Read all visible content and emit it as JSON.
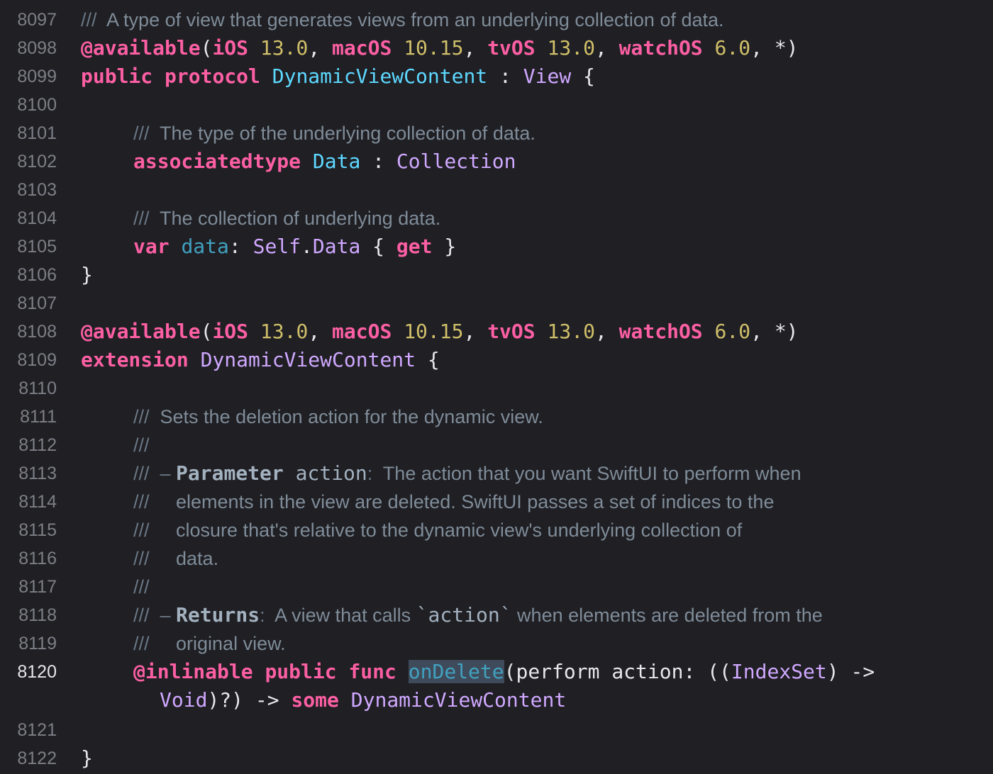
{
  "editor": {
    "colors": {
      "background": "#1f1f24",
      "keyword": "#fc5fa3",
      "type": "#d0a8ff",
      "identifier": "#5dd8ff",
      "number": "#d0bf69",
      "comment": "#7f8c98",
      "selection": "#3f4b5a"
    },
    "current_line": "8120",
    "lines": [
      {
        "num": "8097",
        "indent": 0,
        "segs": [
          [
            "slashes",
            "/// "
          ],
          [
            "comment",
            " A type of view that generates views from an underlying collection of data."
          ]
        ]
      },
      {
        "num": "8098",
        "indent": 0,
        "segs": [
          [
            "attr",
            "@available"
          ],
          [
            "plain",
            "("
          ],
          [
            "keyword",
            "iOS"
          ],
          [
            "plain",
            " "
          ],
          [
            "num",
            "13.0"
          ],
          [
            "plain",
            ", "
          ],
          [
            "keyword",
            "macOS"
          ],
          [
            "plain",
            " "
          ],
          [
            "num",
            "10.15"
          ],
          [
            "plain",
            ", "
          ],
          [
            "keyword",
            "tvOS"
          ],
          [
            "plain",
            " "
          ],
          [
            "num",
            "13.0"
          ],
          [
            "plain",
            ", "
          ],
          [
            "keyword",
            "watchOS"
          ],
          [
            "plain",
            " "
          ],
          [
            "num",
            "6.0"
          ],
          [
            "plain",
            ", *)"
          ]
        ]
      },
      {
        "num": "8099",
        "indent": 0,
        "segs": [
          [
            "keyword",
            "public"
          ],
          [
            "plain",
            " "
          ],
          [
            "keyword",
            "protocol"
          ],
          [
            "plain",
            " "
          ],
          [
            "ident",
            "DynamicViewContent"
          ],
          [
            "plain",
            " : "
          ],
          [
            "type",
            "View"
          ],
          [
            "plain",
            " {"
          ]
        ]
      },
      {
        "num": "8100",
        "indent": 0,
        "segs": []
      },
      {
        "num": "8101",
        "indent": 1,
        "segs": [
          [
            "slashes",
            "/// "
          ],
          [
            "comment",
            " The type of the underlying collection of data."
          ]
        ]
      },
      {
        "num": "8102",
        "indent": 1,
        "segs": [
          [
            "keyword",
            "associatedtype"
          ],
          [
            "plain",
            " "
          ],
          [
            "ident",
            "Data"
          ],
          [
            "plain",
            " : "
          ],
          [
            "type",
            "Collection"
          ]
        ]
      },
      {
        "num": "8103",
        "indent": 0,
        "segs": []
      },
      {
        "num": "8104",
        "indent": 1,
        "segs": [
          [
            "slashes",
            "/// "
          ],
          [
            "comment",
            " The collection of underlying data."
          ]
        ]
      },
      {
        "num": "8105",
        "indent": 1,
        "segs": [
          [
            "keyword",
            "var"
          ],
          [
            "plain",
            " "
          ],
          [
            "iddecl",
            "data"
          ],
          [
            "plain",
            ": "
          ],
          [
            "type",
            "Self"
          ],
          [
            "plain",
            "."
          ],
          [
            "type",
            "Data"
          ],
          [
            "plain",
            " { "
          ],
          [
            "keyword",
            "get"
          ],
          [
            "plain",
            " }"
          ]
        ]
      },
      {
        "num": "8106",
        "indent": 0,
        "segs": [
          [
            "plain",
            "}"
          ]
        ]
      },
      {
        "num": "8107",
        "indent": 0,
        "segs": []
      },
      {
        "num": "8108",
        "indent": 0,
        "segs": [
          [
            "attr",
            "@available"
          ],
          [
            "plain",
            "("
          ],
          [
            "keyword",
            "iOS"
          ],
          [
            "plain",
            " "
          ],
          [
            "num",
            "13.0"
          ],
          [
            "plain",
            ", "
          ],
          [
            "keyword",
            "macOS"
          ],
          [
            "plain",
            " "
          ],
          [
            "num",
            "10.15"
          ],
          [
            "plain",
            ", "
          ],
          [
            "keyword",
            "tvOS"
          ],
          [
            "plain",
            " "
          ],
          [
            "num",
            "13.0"
          ],
          [
            "plain",
            ", "
          ],
          [
            "keyword",
            "watchOS"
          ],
          [
            "plain",
            " "
          ],
          [
            "num",
            "6.0"
          ],
          [
            "plain",
            ", *)"
          ]
        ]
      },
      {
        "num": "8109",
        "indent": 0,
        "segs": [
          [
            "keyword",
            "extension"
          ],
          [
            "plain",
            " "
          ],
          [
            "type",
            "DynamicViewContent"
          ],
          [
            "plain",
            " {"
          ]
        ]
      },
      {
        "num": "8110",
        "indent": 0,
        "segs": []
      },
      {
        "num": "8111",
        "indent": 1,
        "segs": [
          [
            "slashes",
            "/// "
          ],
          [
            "comment",
            " Sets the deletion action for the dynamic view."
          ]
        ]
      },
      {
        "num": "8112",
        "indent": 1,
        "segs": [
          [
            "slashes",
            "///"
          ]
        ]
      },
      {
        "num": "8113",
        "indent": 1,
        "segs": [
          [
            "slashes",
            "/// "
          ],
          [
            "slashes",
            " – "
          ],
          [
            "docbold",
            "Parameter"
          ],
          [
            "docparam",
            " action"
          ],
          [
            "slashes",
            ":"
          ],
          [
            "comment",
            "  The action that you want SwiftUI to perform when"
          ]
        ]
      },
      {
        "num": "8114",
        "indent": 1,
        "segs": [
          [
            "slashes",
            "/// "
          ],
          [
            "comment",
            "    elements in the view are deleted. SwiftUI passes a set of indices to the"
          ]
        ]
      },
      {
        "num": "8115",
        "indent": 1,
        "segs": [
          [
            "slashes",
            "/// "
          ],
          [
            "comment",
            "    closure that's relative to the dynamic view's underlying collection of"
          ]
        ]
      },
      {
        "num": "8116",
        "indent": 1,
        "segs": [
          [
            "slashes",
            "/// "
          ],
          [
            "comment",
            "    data."
          ]
        ]
      },
      {
        "num": "8117",
        "indent": 1,
        "segs": [
          [
            "slashes",
            "///"
          ]
        ]
      },
      {
        "num": "8118",
        "indent": 1,
        "segs": [
          [
            "slashes",
            "/// "
          ],
          [
            "slashes",
            " – "
          ],
          [
            "docbold",
            "Returns"
          ],
          [
            "slashes",
            ":"
          ],
          [
            "comment",
            "  A view that calls "
          ],
          [
            "docmono",
            "`action`"
          ],
          [
            "comment",
            " when elements are deleted from the"
          ]
        ]
      },
      {
        "num": "8119",
        "indent": 1,
        "segs": [
          [
            "slashes",
            "/// "
          ],
          [
            "comment",
            "    original view."
          ]
        ]
      },
      {
        "num": "8120",
        "indent": 1,
        "segs": [
          [
            "attr",
            "@inlinable"
          ],
          [
            "plain",
            " "
          ],
          [
            "keyword",
            "public"
          ],
          [
            "plain",
            " "
          ],
          [
            "keyword",
            "func"
          ],
          [
            "plain",
            " "
          ],
          [
            "selected",
            "onDelete"
          ],
          [
            "plain",
            "(perform action: (("
          ],
          [
            "type",
            "IndexSet"
          ],
          [
            "plain",
            ") ->"
          ]
        ]
      },
      {
        "num": "",
        "indent": 1.5,
        "segs": [
          [
            "type",
            "Void"
          ],
          [
            "plain",
            ")?) -> "
          ],
          [
            "keyword",
            "some"
          ],
          [
            "plain",
            " "
          ],
          [
            "type",
            "DynamicViewContent"
          ]
        ]
      },
      {
        "num": "8121",
        "indent": 0,
        "segs": []
      },
      {
        "num": "8122",
        "indent": 0,
        "segs": [
          [
            "plain",
            "}"
          ]
        ]
      }
    ]
  }
}
